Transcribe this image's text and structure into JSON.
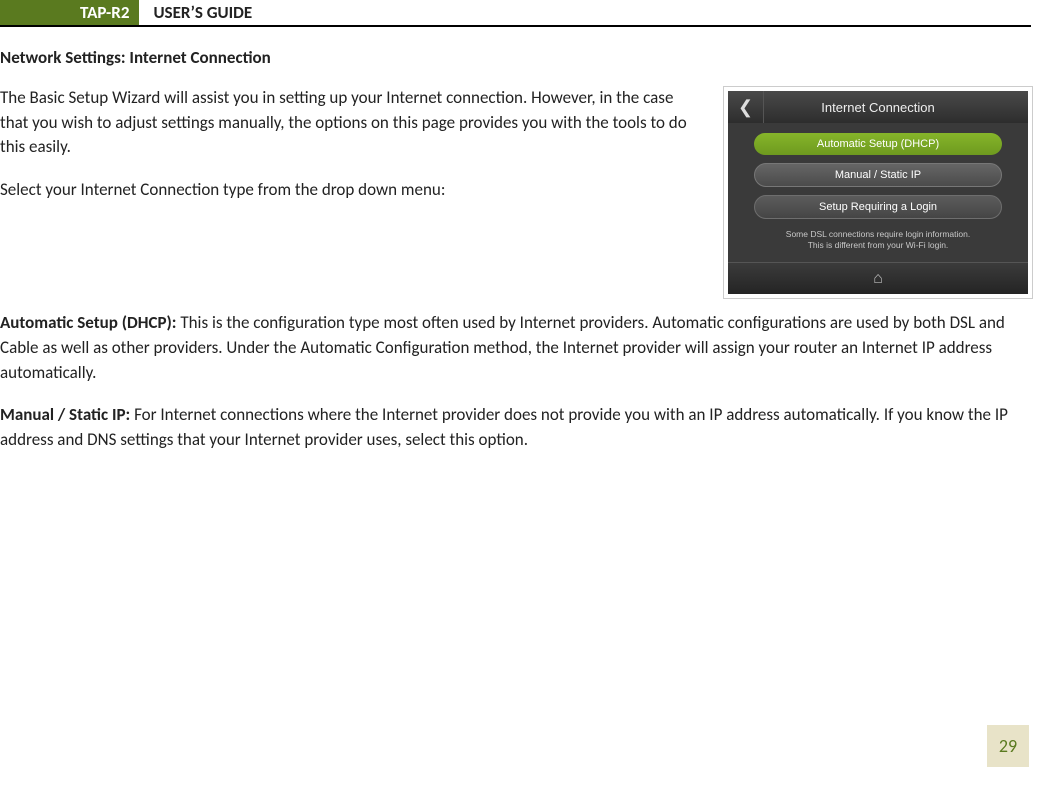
{
  "header": {
    "badge": "TAP-R2",
    "title": "USER’S GUIDE"
  },
  "section_title": "Network Settings: Internet Connection",
  "intro_p1": "The Basic Setup Wizard will assist you in setting up your Internet connection. However, in the case that you wish to adjust settings manually, the options on this page provides you with the tools to do this easily.",
  "intro_p2": "Select your Internet Connection type from the drop down menu:",
  "dhcp": {
    "label": "Automatic Setup (DHCP):",
    "text": " This is the configuration type most often used by Internet providers. Automatic configurations are used by both DSL and Cable as well as other providers. Under the Automatic Configuration method, the Internet provider will assign your router an Internet IP address automatically."
  },
  "static": {
    "label": "Manual / Static IP:",
    "text": " For Internet connections where the Internet provider does not provide you with an IP address automatically. If you know the IP address and DNS settings that your Internet provider uses, select this option."
  },
  "phone": {
    "title": "Internet Connection",
    "opt_dhcp": "Automatic Setup (DHCP)",
    "opt_static": "Manual / Static IP",
    "opt_login": "Setup Requiring a Login",
    "note_l1": "Some DSL connections require login information.",
    "note_l2": "This is different from your Wi-Fi login."
  },
  "page_number": "29"
}
